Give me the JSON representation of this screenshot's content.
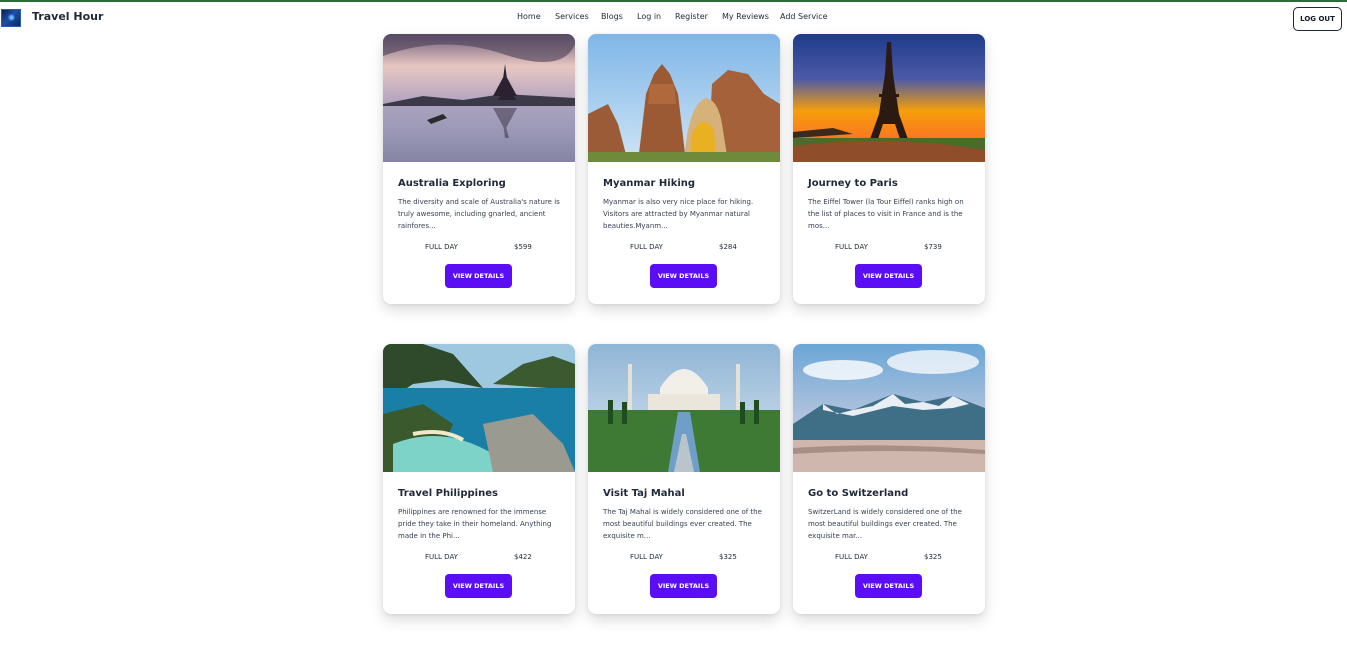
{
  "brand": {
    "name": "Travel Hour"
  },
  "nav": {
    "links": [
      "Home",
      "Services",
      "Blogs",
      "Log in",
      "Register",
      "My Reviews",
      "Add Service"
    ],
    "logout_label": "LOG OUT"
  },
  "services": [
    {
      "title": "Australia Exploring",
      "description": "The diversity and scale of Australia's nature is truly awesome, including gnarled, ancient rainfores...",
      "duration": "FULL DAY",
      "price": "$599",
      "button": "VIEW DETAILS"
    },
    {
      "title": "Myanmar Hiking",
      "description": "Myanmar is also very nice place for hiking. Visitors are attracted by Myanmar natural beauties.Myanm...",
      "duration": "FULL DAY",
      "price": "$284",
      "button": "VIEW DETAILS"
    },
    {
      "title": "Journey to Paris",
      "description": "The Eiffel Tower (la Tour Eiffel) ranks high on the list of places to visit in France and is the mos...",
      "duration": "FULL DAY",
      "price": "$739",
      "button": "VIEW DETAILS"
    },
    {
      "title": "Travel Philippines",
      "description": "Philippines are renowned for the immense pride they take in their homeland. Anything made in the Phi...",
      "duration": "FULL DAY",
      "price": "$422",
      "button": "VIEW DETAILS"
    },
    {
      "title": "Visit Taj Mahal",
      "description": "The Taj Mahal is widely considered one of the most beautiful buildings ever created. The exquisite m...",
      "duration": "FULL DAY",
      "price": "$325",
      "button": "VIEW DETAILS"
    },
    {
      "title": "Go to Switzerland",
      "description": "SwitzerLand is widely considered one of the most beautiful buildings ever created. The exquisite mar...",
      "duration": "FULL DAY",
      "price": "$325",
      "button": "VIEW DETAILS"
    }
  ],
  "colors": {
    "button": "#5b0ef5",
    "topline": "#2e6b3a"
  }
}
